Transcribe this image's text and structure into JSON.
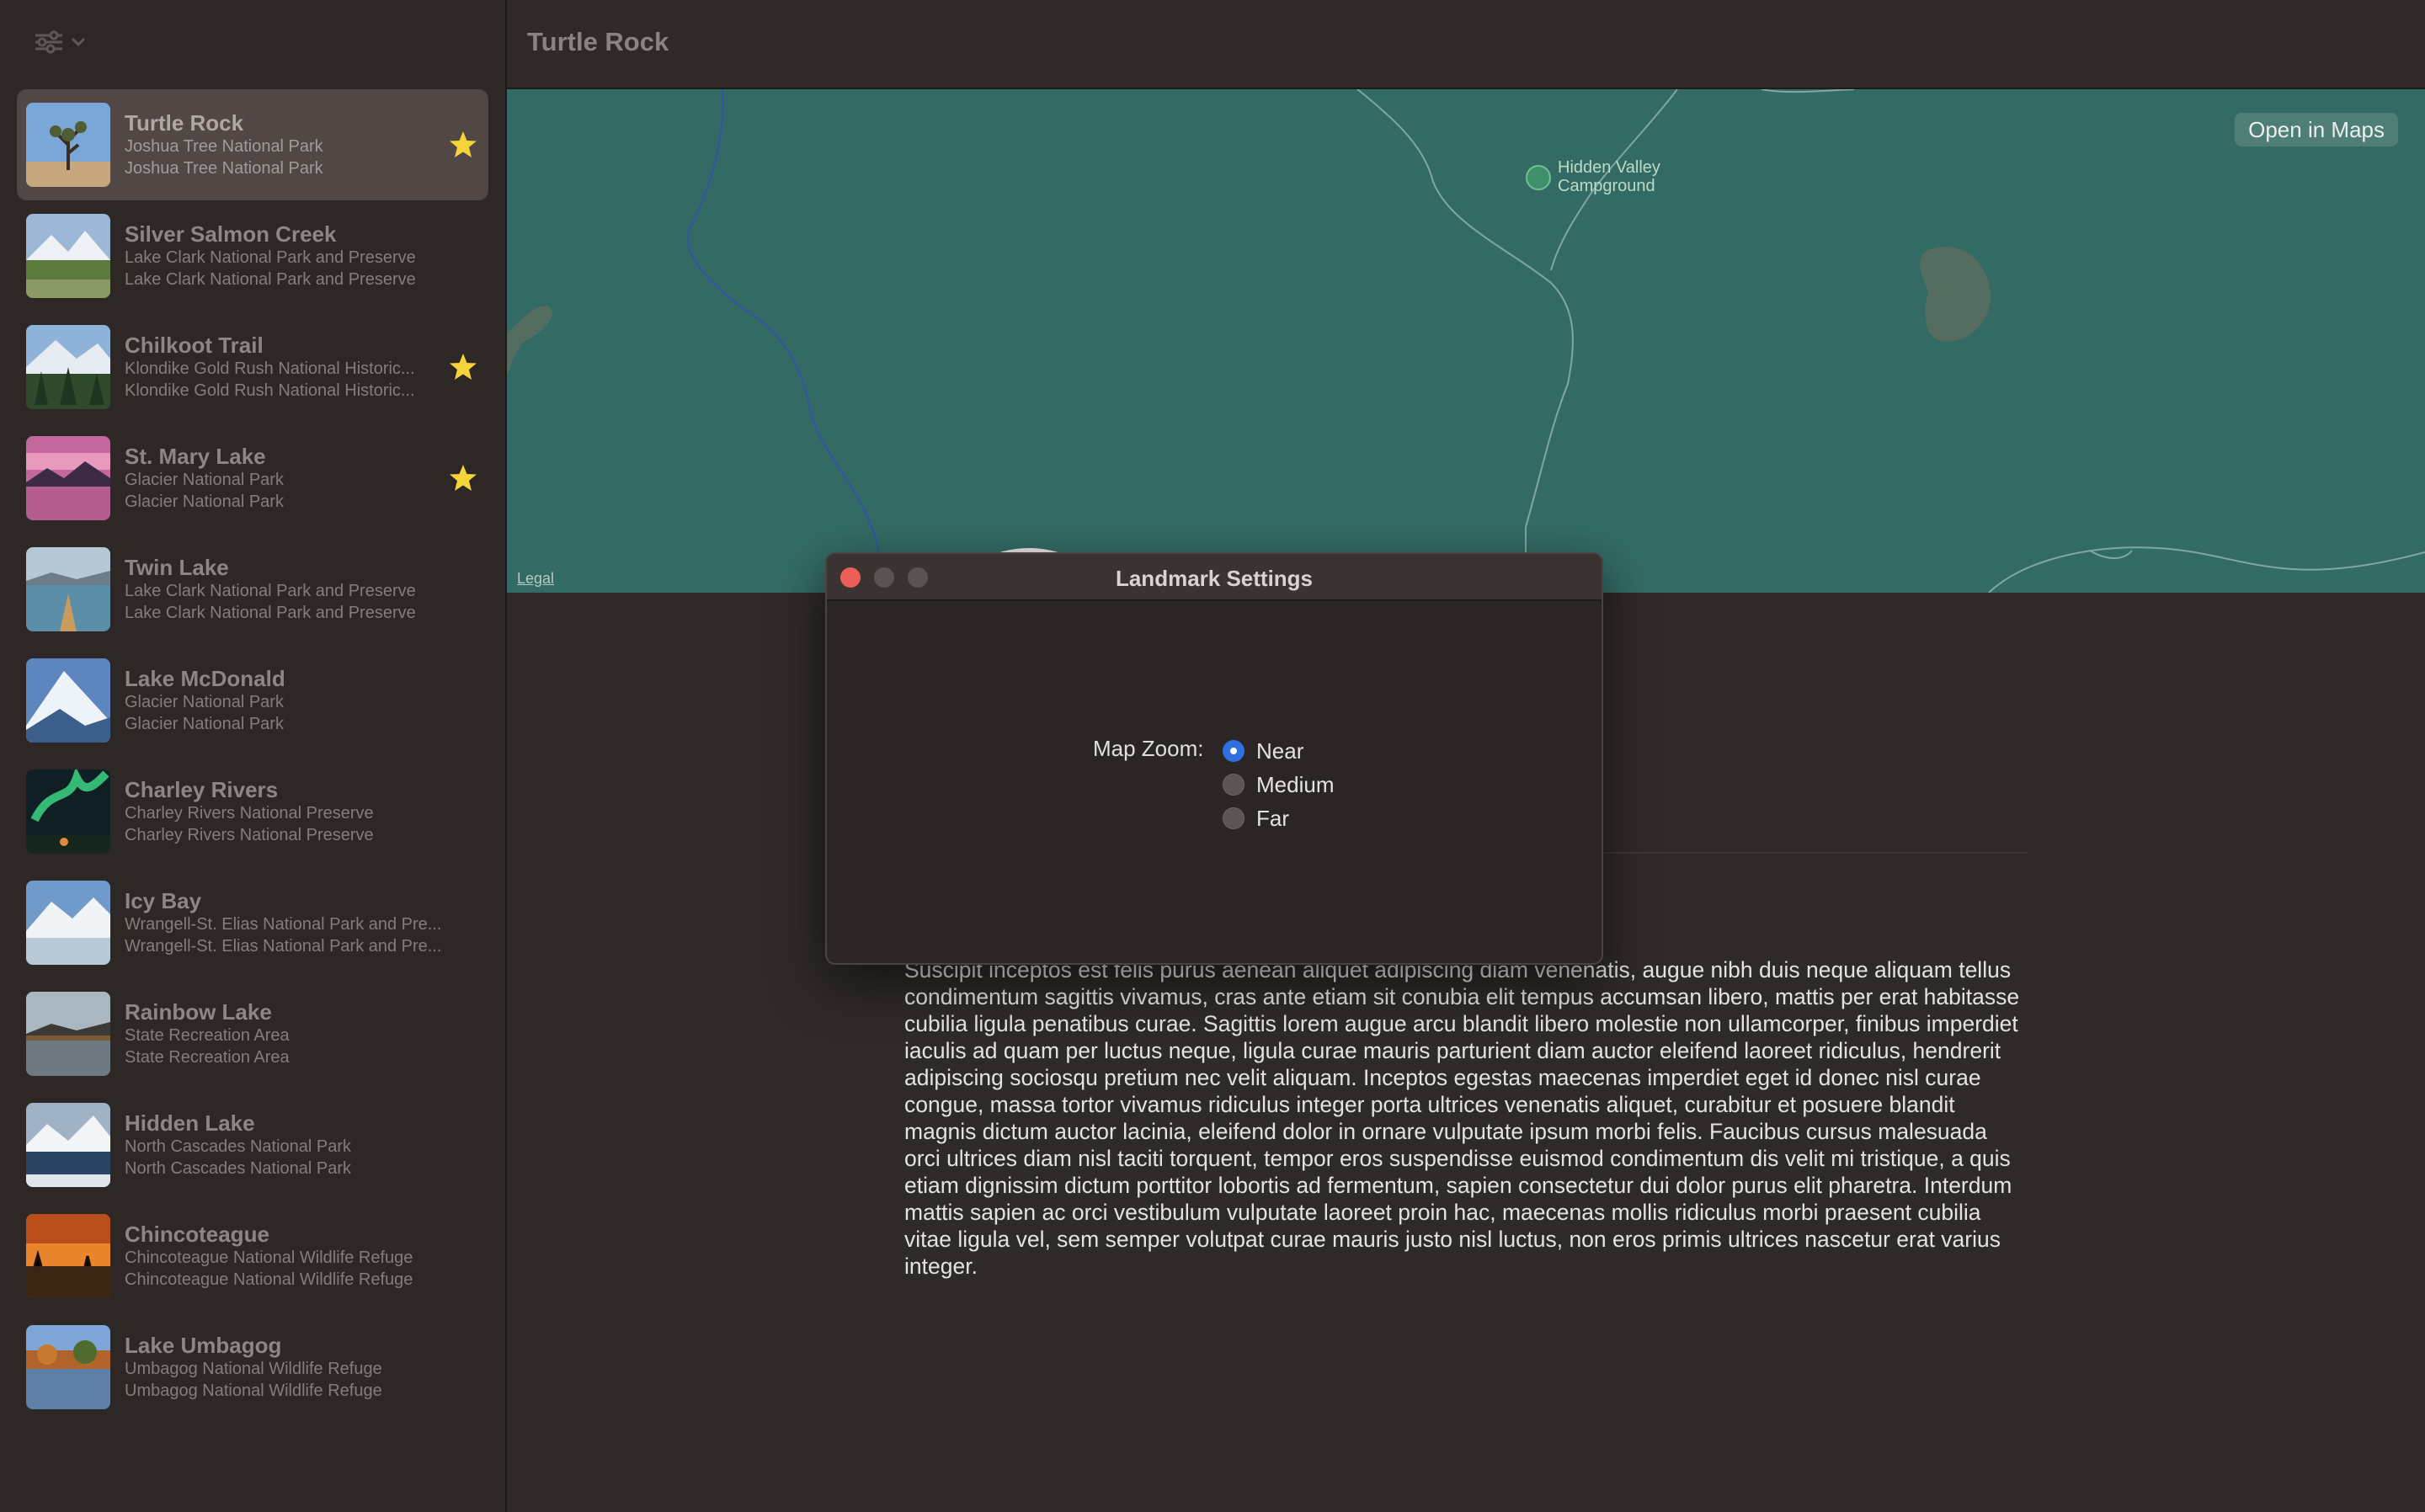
{
  "sidebar": {
    "items": [
      {
        "name": "Turtle Rock",
        "park": "Joshua Tree National Park",
        "state": "Joshua Tree National Park",
        "favorite": true,
        "selected": true,
        "thumb": "desert-tree"
      },
      {
        "name": "Silver Salmon Creek",
        "park": "Lake Clark National Park and Preserve",
        "state": "Lake Clark National Park and Preserve",
        "favorite": false,
        "selected": false,
        "thumb": "mountain-meadow"
      },
      {
        "name": "Chilkoot Trail",
        "park": "Klondike Gold Rush National Historic...",
        "state": "Klondike Gold Rush National Historic...",
        "favorite": true,
        "selected": false,
        "thumb": "forest-peaks"
      },
      {
        "name": "St. Mary Lake",
        "park": "Glacier National Park",
        "state": "Glacier National Park",
        "favorite": true,
        "selected": false,
        "thumb": "pink-sunset-lake"
      },
      {
        "name": "Twin Lake",
        "park": "Lake Clark National Park and Preserve",
        "state": "Lake Clark National Park and Preserve",
        "favorite": false,
        "selected": false,
        "thumb": "canoe-lake"
      },
      {
        "name": "Lake McDonald",
        "park": "Glacier National Park",
        "state": "Glacier National Park",
        "favorite": false,
        "selected": false,
        "thumb": "snow-peak"
      },
      {
        "name": "Charley Rivers",
        "park": "Charley Rivers National Preserve",
        "state": "Charley Rivers National Preserve",
        "favorite": false,
        "selected": false,
        "thumb": "aurora"
      },
      {
        "name": "Icy Bay",
        "park": "Wrangell-St. Elias National Park and Pre...",
        "state": "Wrangell-St. Elias National Park and Pre...",
        "favorite": false,
        "selected": false,
        "thumb": "icy-mountains"
      },
      {
        "name": "Rainbow Lake",
        "park": "State Recreation Area",
        "state": "State Recreation Area",
        "favorite": false,
        "selected": false,
        "thumb": "reflection-lake"
      },
      {
        "name": "Hidden Lake",
        "park": "North Cascades National Park",
        "state": "North Cascades National Park",
        "favorite": false,
        "selected": false,
        "thumb": "winter-lake"
      },
      {
        "name": "Chincoteague",
        "park": "Chincoteague National Wildlife Refuge",
        "state": "Chincoteague National Wildlife Refuge",
        "favorite": false,
        "selected": false,
        "thumb": "orange-sunset"
      },
      {
        "name": "Lake Umbagog",
        "park": "Umbagog National Wildlife Refuge",
        "state": "Umbagog National Wildlife Refuge",
        "favorite": false,
        "selected": false,
        "thumb": "autumn-lake"
      }
    ]
  },
  "header": {
    "title": "Turtle Rock"
  },
  "map": {
    "open_in_maps": "Open in Maps",
    "legal": "Legal",
    "campground_line1": "Hidden Valley",
    "campground_line2": "Campground"
  },
  "settings": {
    "title": "Landmark Settings",
    "zoom_label": "Map Zoom:",
    "options": [
      "Near",
      "Medium",
      "Far"
    ],
    "selected": "Near"
  },
  "content": {
    "description": "Suscipit inceptos est felis purus aenean aliquet adipiscing diam venenatis, augue nibh duis neque aliquam tellus condimentum sagittis vivamus, cras ante etiam sit conubia elit tempus accumsan libero, mattis per erat habitasse cubilia ligula penatibus curae. Sagittis lorem augue arcu blandit libero molestie non ullamcorper, finibus imperdiet iaculis ad quam per luctus neque, ligula curae mauris parturient diam auctor eleifend laoreet ridiculus, hendrerit adipiscing sociosqu pretium nec velit aliquam. Inceptos egestas maecenas imperdiet eget id donec nisl curae congue, massa tortor vivamus ridiculus integer porta ultrices venenatis aliquet, curabitur et posuere blandit magnis dictum auctor lacinia, eleifend dolor in ornare vulputate ipsum morbi felis. Faucibus cursus malesuada orci ultrices diam nisl taciti torquent, tempor eros suspendisse euismod condimentum dis velit mi tristique, a quis etiam dignissim dictum porttitor lobortis ad fermentum, sapien consectetur dui dolor purus elit pharetra. Interdum mattis sapien ac orci vestibulum vulputate laoreet proin hac, maecenas mollis ridiculus morbi praesent cubilia vitae ligula vel, sem semper volutpat curae mauris justo nisl luctus, non eros primis ultrices nascetur erat varius integer."
  },
  "colors": {
    "accent_radio": "#2f6fe0",
    "star": "#f5d43a",
    "map_land": "#336b64",
    "close_button": "#ec5f57"
  }
}
